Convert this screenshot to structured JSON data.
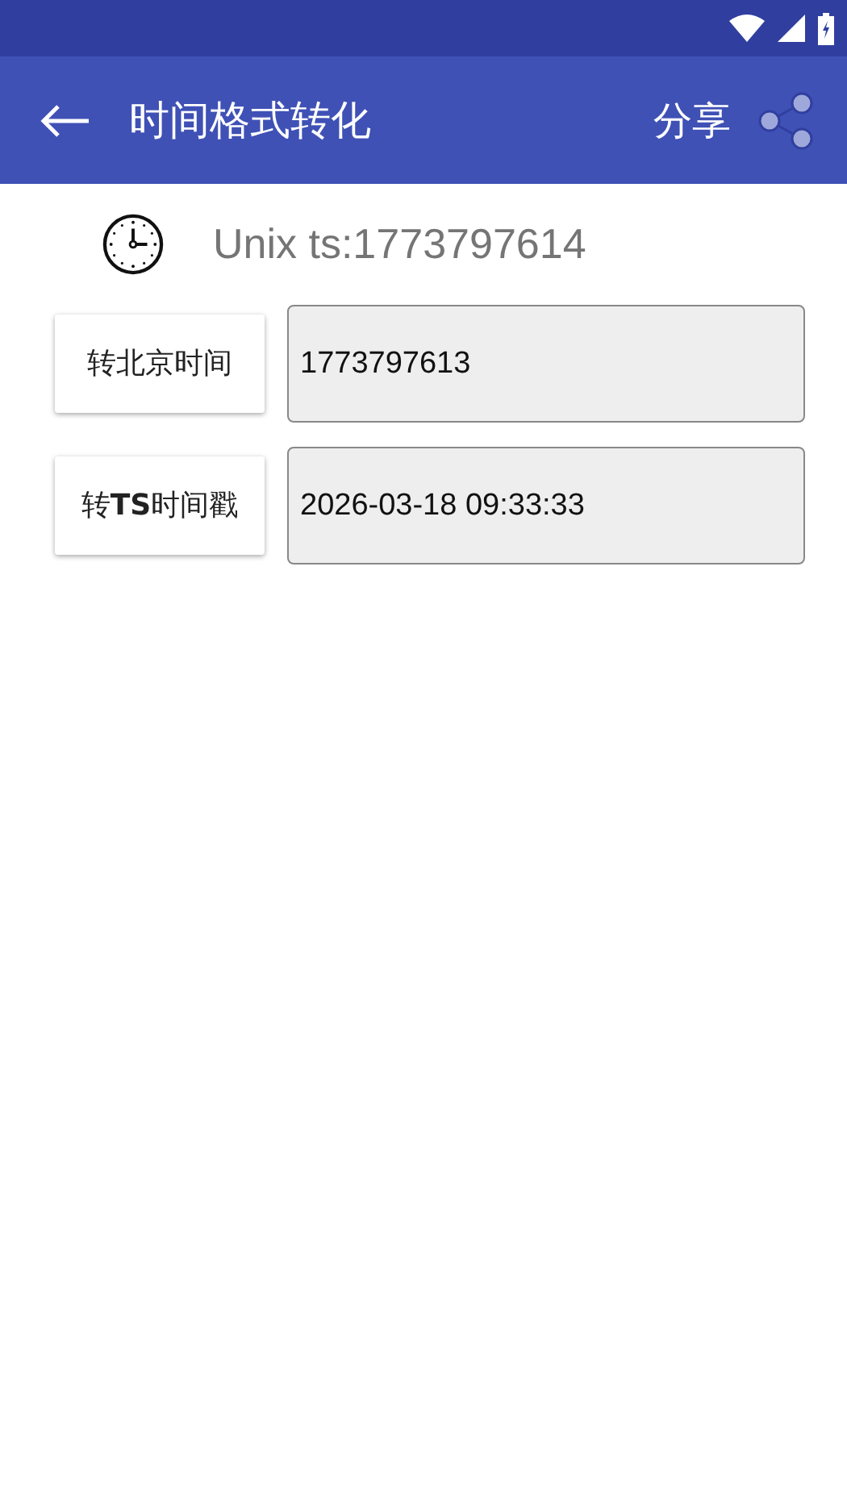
{
  "app_bar": {
    "title": "时间格式转化",
    "share_label": "分享"
  },
  "unix_timestamp": "Unix ts:1773797614",
  "rows": [
    {
      "button": "转北京时间",
      "value": "1773797613"
    },
    {
      "button": "转**TS**时间戳",
      "value": "2026-03-18 09:33:33"
    }
  ]
}
